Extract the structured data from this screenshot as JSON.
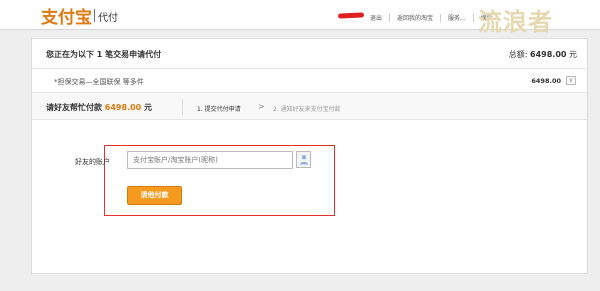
{
  "header": {
    "logo_text": "支付宝",
    "product_name": "代付",
    "nav": [
      "退出",
      "返回我的淘宝",
      "服务...",
      "搜索..."
    ],
    "watermark": "流浪者"
  },
  "order": {
    "title": "您正在为以下 1 笔交易申请代付",
    "total_label": "总额:",
    "total_amount": "6498.00",
    "currency": "元",
    "item_description": "*担保交易—全国联保 等多件",
    "item_price": "6498.00",
    "expand_symbol": "∨"
  },
  "steps": {
    "prompt": "请好友帮忙付款",
    "amount": "6498.00",
    "currency": "元",
    "step1": "1. 提交代付申请",
    "arrow": ">",
    "step2": "2. 通知好友来支付宝付款"
  },
  "form": {
    "account_label": "好友的账户",
    "account_placeholder": "支付宝账户/淘宝账户(昵称)",
    "submit_label": "请他付款"
  },
  "colors": {
    "brand_orange": "#e07a10",
    "button_orange": "#f39a1f",
    "highlight_red": "#e03030"
  }
}
